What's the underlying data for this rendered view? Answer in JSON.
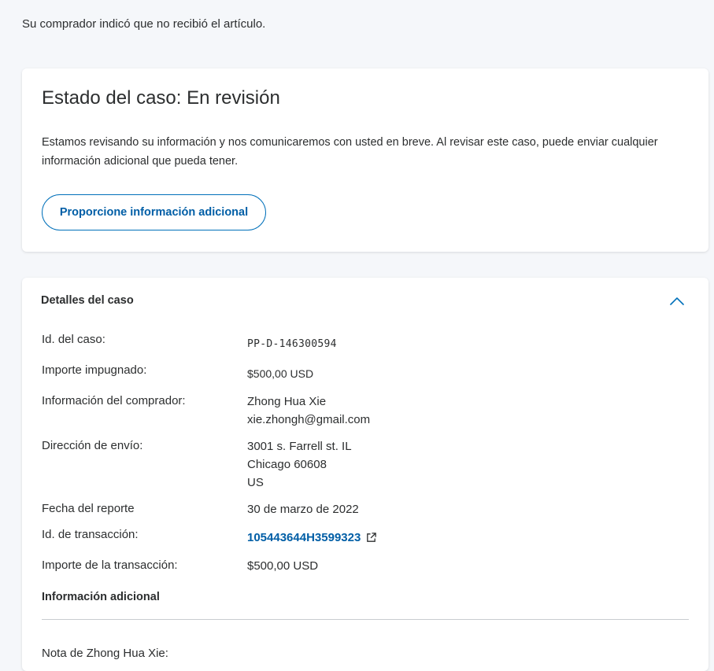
{
  "intro_text": "Su comprador indicó que no recibió el artículo.",
  "status_card": {
    "title": "Estado del caso: En revisión",
    "description": "Estamos revisando su información y nos comunicaremos con usted en breve. Al revisar este caso, puede enviar cualquier información adicional que pueda tener.",
    "button_label": "Proporcione información adicional"
  },
  "details": {
    "title": "Detalles del caso",
    "collapse_icon": "chevron-up-icon",
    "rows": {
      "case_id": {
        "label": "Id. del caso:",
        "value": "PP-D-146300594"
      },
      "disputed_amount": {
        "label": "Importe impugnado:",
        "value": "$500,00 USD"
      },
      "buyer_info": {
        "label": "Información del comprador:",
        "name": "Zhong Hua Xie",
        "email": "xie.zhongh@gmail.com"
      },
      "shipping_address": {
        "label": "Dirección de envío:",
        "line1": "3001 s. Farrell st. IL",
        "line2": "Chicago 60608",
        "line3": "US"
      },
      "report_date": {
        "label": "Fecha del reporte",
        "value": "30 de marzo de 2022"
      },
      "transaction_id": {
        "label": "Id. de transacción:",
        "value": "105443644H3599323",
        "icon": "external-link-icon"
      },
      "transaction_amount": {
        "label": "Importe de la transacción:",
        "value": "$500,00 USD"
      }
    },
    "additional_info_title": "Información adicional",
    "note_label": "Nota de Zhong Hua Xie:"
  },
  "colors": {
    "accent": "#0070ba",
    "link": "#005ea6",
    "background": "#f5f7fa",
    "card": "#ffffff"
  }
}
